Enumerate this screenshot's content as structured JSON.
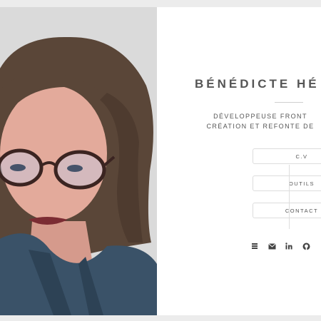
{
  "profile": {
    "name": "BÉNÉDICTE HÉ",
    "tagline_line1": "DÉVELOPPEUSE FRONT",
    "tagline_line2": "CRÉATION ET REFONTE DE",
    "photo_icon": "portrait-photo"
  },
  "nav": {
    "cv": "C.V",
    "outils": "OUTILS",
    "contact": "CONTACT"
  },
  "socials": [
    {
      "icon": "stack-icon"
    },
    {
      "icon": "envelope-icon"
    },
    {
      "icon": "linkedin-icon"
    },
    {
      "icon": "github-icon"
    }
  ],
  "colors": {
    "text": "#555555",
    "border": "#dddddd",
    "background": "#ffffff",
    "page": "#ececec"
  }
}
